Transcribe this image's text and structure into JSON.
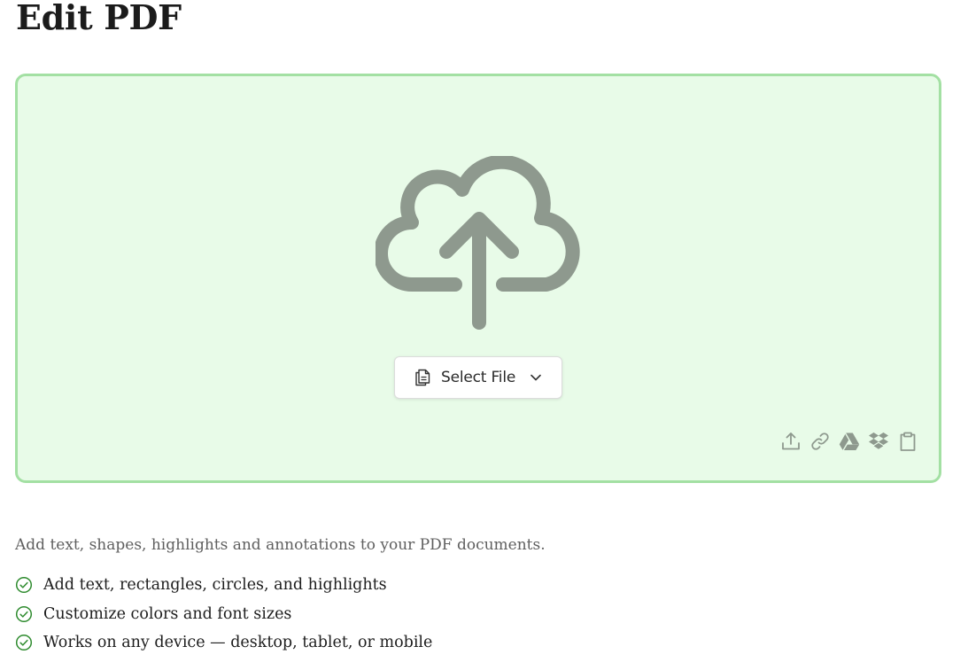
{
  "page": {
    "title": "Edit PDF"
  },
  "dropzone": {
    "background": "#e8fbe8",
    "border_color": "#a3e0a3",
    "upload_icon": "cloud-upload-icon",
    "icon_color": "#8e998e",
    "select_button": {
      "label": "Select File",
      "icon": "file-copy-icon",
      "dropdown_icon": "chevron-down-icon"
    },
    "sources": [
      {
        "icon": "upload-icon"
      },
      {
        "icon": "link-icon"
      },
      {
        "icon": "google-drive-icon"
      },
      {
        "icon": "dropbox-icon"
      },
      {
        "icon": "clipboard-icon"
      }
    ]
  },
  "description": "Add text, shapes, highlights and annotations to your PDF documents.",
  "features": {
    "check_color": "#2e8b2e",
    "items": [
      "Add text, rectangles, circles, and highlights",
      "Customize colors and font sizes",
      "Works on any device — desktop, tablet, or mobile"
    ]
  }
}
